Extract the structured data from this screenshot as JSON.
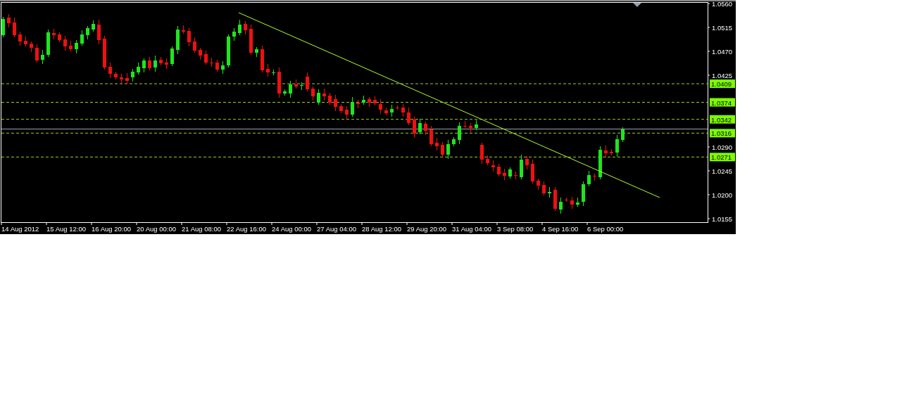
{
  "chart": {
    "price_ticks": [
      "1.0560",
      "1.0515",
      "1.0470",
      "1.0425",
      "1.0290",
      "1.0245",
      "1.0200",
      "1.0155"
    ],
    "price_levels": [
      {
        "label": "1.0409"
      },
      {
        "label": "1.0374"
      },
      {
        "label": "1.0342"
      },
      {
        "label": "1.0316"
      },
      {
        "label": "1.0271"
      }
    ],
    "time_labels": [
      "14 Aug 2012",
      "15 Aug 12:00",
      "16 Aug 20:00",
      "20 Aug 00:00",
      "21 Aug 08:00",
      "22 Aug 16:00",
      "24 Aug 00:00",
      "27 Aug 04:00",
      "28 Aug 12:00",
      "29 Aug 20:00",
      "31 Aug 04:00",
      "3 Sep 08:00",
      "4 Sep 16:00",
      "6 Sep 00:00"
    ]
  }
}
